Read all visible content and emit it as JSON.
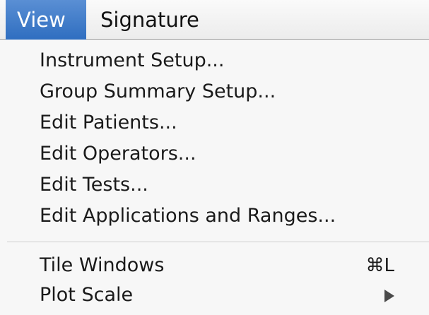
{
  "menubar": {
    "view_label": "View",
    "signature_label": "Signature"
  },
  "view_menu": {
    "items": [
      {
        "label": "Instrument Setup..."
      },
      {
        "label": "Group Summary Setup..."
      },
      {
        "label": "Edit Patients..."
      },
      {
        "label": "Edit Operators..."
      },
      {
        "label": "Edit Tests..."
      },
      {
        "label": "Edit Applications and Ranges..."
      }
    ],
    "tile_windows": {
      "label": "Tile Windows",
      "shortcut": "⌘L"
    },
    "plot_scale": {
      "label": "Plot Scale",
      "submenu_icon": "triangle-right-icon"
    }
  }
}
